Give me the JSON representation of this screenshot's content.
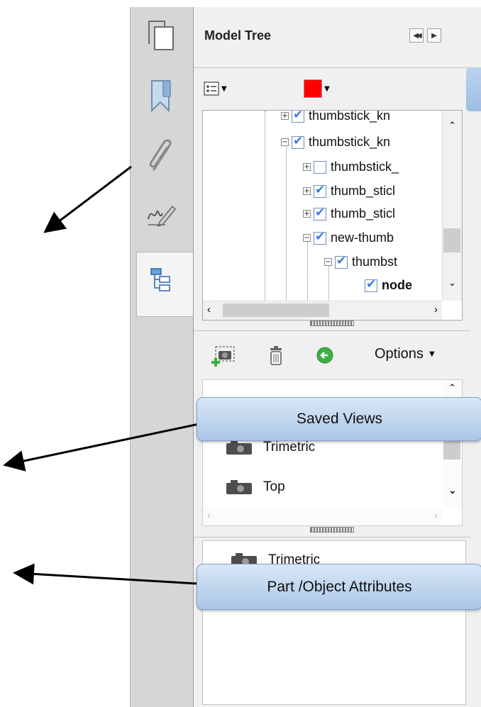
{
  "panel": {
    "title": "Model Tree",
    "nav_buttons": [
      "◀◀",
      "▶"
    ],
    "toolbar_icons": [
      "list-options-icon",
      "color-swatch-icon"
    ],
    "swatch_color": "#ff0000"
  },
  "tree": {
    "nodes": [
      {
        "label": "thumbstick_kn",
        "checked": true,
        "expander": "+",
        "level": 1
      },
      {
        "label": "thumbstick_kn",
        "checked": true,
        "expander": "−",
        "level": 1
      },
      {
        "label": "thumbstick_",
        "checked": false,
        "expander": "+",
        "level": 2
      },
      {
        "label": "thumb_sticl",
        "checked": true,
        "expander": "+",
        "level": 2
      },
      {
        "label": "thumb_sticl",
        "checked": true,
        "expander": "+",
        "level": 2
      },
      {
        "label": "new-thumb",
        "checked": true,
        "expander": "−",
        "level": 2
      },
      {
        "label": "thumbst",
        "checked": true,
        "expander": "−",
        "level": 3
      },
      {
        "label": "node",
        "checked": true,
        "expander": "",
        "level": 4,
        "bold": true
      }
    ]
  },
  "views": {
    "options_label": "Options",
    "items": [
      {
        "label": "Trimetric"
      },
      {
        "label": "Top"
      }
    ]
  },
  "attributes": {
    "first_item": "Trimetric"
  },
  "callouts": {
    "saved_views": "Saved Views",
    "part_attributes": "Part /Object Attributes"
  },
  "colors": {
    "callout_fill": "#bcd3ee",
    "accent_blue": "#3b7ad6",
    "green_button": "#3cb043"
  }
}
